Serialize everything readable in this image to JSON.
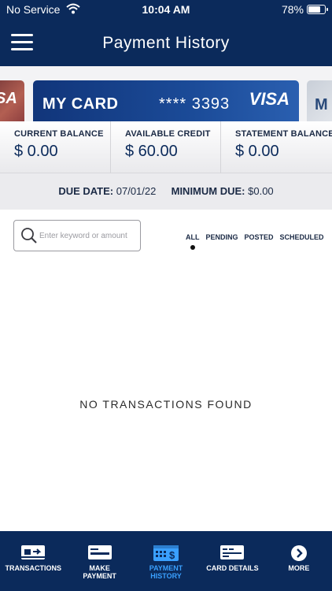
{
  "status_bar": {
    "carrier": "No Service",
    "time": "10:04 AM",
    "battery": "78%"
  },
  "header": {
    "title": "Payment History"
  },
  "cards": {
    "left_brand": "SA",
    "main": {
      "name": "MY CARD",
      "number": "**** 3393",
      "brand": "VISA"
    },
    "right_brand": "M"
  },
  "balances": [
    {
      "label": "CURRENT BALANCE",
      "value": "$ 0.00"
    },
    {
      "label": "AVAILABLE CREDIT",
      "value": "$ 60.00"
    },
    {
      "label": "STATEMENT BALANCE",
      "value": "$ 0.00"
    }
  ],
  "due": {
    "due_label": "DUE DATE:",
    "due_value": "07/01/22",
    "min_label": "MINIMUM DUE:",
    "min_value": "$0.00"
  },
  "search": {
    "placeholder": "Enter keyword or amount"
  },
  "filters": [
    "ALL",
    "PENDING",
    "POSTED",
    "SCHEDULED"
  ],
  "empty_message": "NO TRANSACTIONS FOUND",
  "tabs": [
    {
      "label": "TRANSACTIONS",
      "icon": "transactions-icon"
    },
    {
      "label": "MAKE\nPAYMENT",
      "icon": "make-payment-icon"
    },
    {
      "label": "PAYMENT\nHISTORY",
      "icon": "payment-history-icon"
    },
    {
      "label": "CARD DETAILS",
      "icon": "card-details-icon"
    },
    {
      "label": "MORE",
      "icon": "more-icon"
    }
  ],
  "colors": {
    "navy": "#0b2a5b",
    "active_tab": "#3aa0ff"
  }
}
